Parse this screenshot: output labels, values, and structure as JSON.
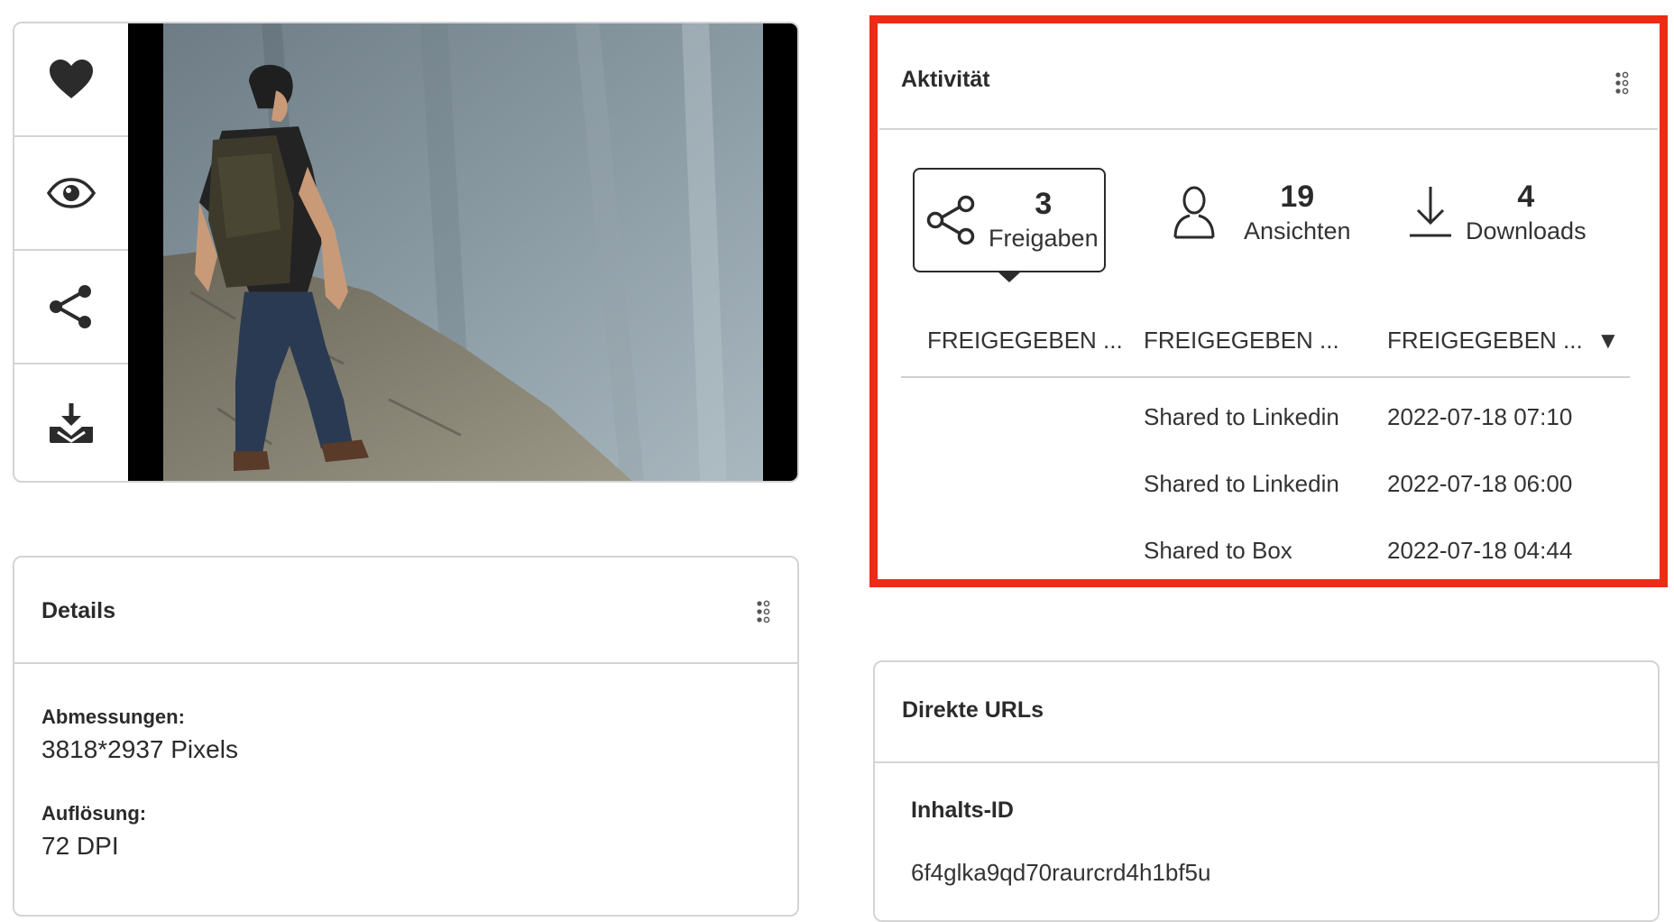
{
  "media": {
    "actions": [
      {
        "name": "heart-icon"
      },
      {
        "name": "eye-icon"
      },
      {
        "name": "share-icon"
      },
      {
        "name": "download-icon"
      }
    ]
  },
  "details": {
    "title": "Details",
    "fields": [
      {
        "label": "Abmessungen:",
        "value": "3818*2937 Pixels"
      },
      {
        "label": "Auflösung:",
        "value": "72 DPI"
      }
    ]
  },
  "activity": {
    "title": "Aktivität",
    "stats": {
      "shares": {
        "count": "3",
        "label": "Freigaben"
      },
      "views": {
        "count": "19",
        "label": "Ansichten"
      },
      "downloads": {
        "count": "4",
        "label": "Downloads"
      }
    },
    "columns": [
      "FREIGEGEBEN ...",
      "FREIGEGEBEN ...",
      "FREIGEGEBEN ..."
    ],
    "rows": [
      {
        "by": "",
        "target": "Shared to Linkedin",
        "date": "2022-07-18 07:10"
      },
      {
        "by": "",
        "target": "Shared to Linkedin",
        "date": "2022-07-18 06:00"
      },
      {
        "by": "",
        "target": "Shared to Box",
        "date": "2022-07-18 04:44"
      }
    ]
  },
  "urls": {
    "title": "Direkte URLs",
    "content_id_label": "Inhalts-ID",
    "content_id_value": "6f4glka9qd70raurcrd4h1bf5u"
  },
  "colors": {
    "highlight": "#ee2b14",
    "border": "#d4d4d4",
    "text": "#2b2b2b"
  }
}
